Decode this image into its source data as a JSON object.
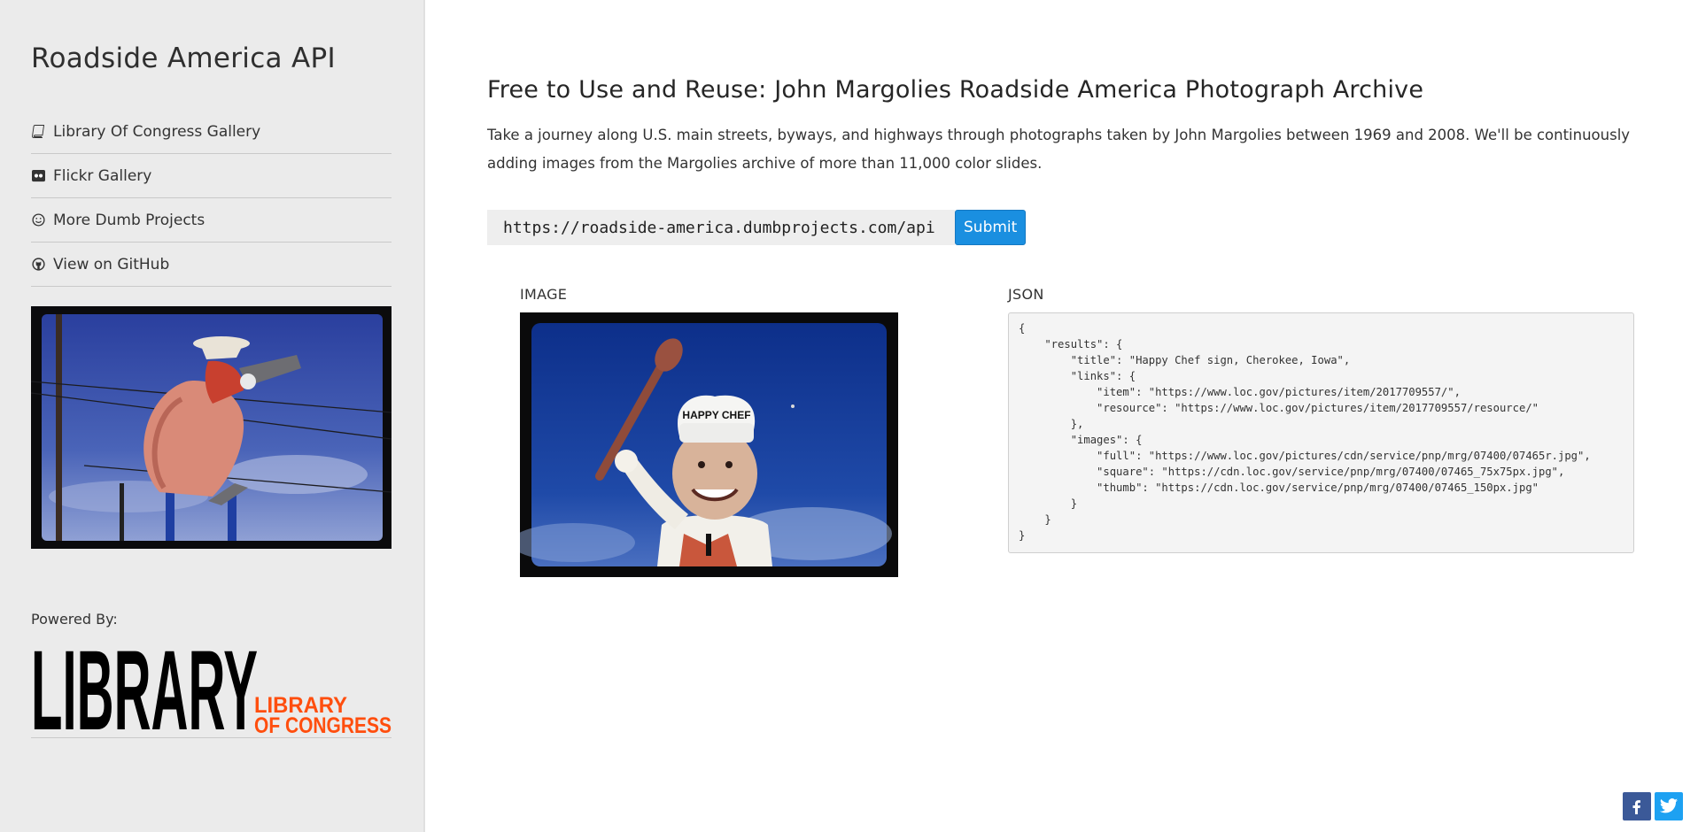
{
  "sidebar": {
    "title": "Roadside America API",
    "nav": [
      {
        "label": "Library Of Congress Gallery",
        "icon": "book-icon"
      },
      {
        "label": "Flickr Gallery",
        "icon": "flickr-icon"
      },
      {
        "label": "More Dumb Projects",
        "icon": "smile-icon"
      },
      {
        "label": "View on GitHub",
        "icon": "github-icon"
      }
    ],
    "photo_alt": "Giant shrimp cowboy sign",
    "powered_by": "Powered By:",
    "logo": {
      "big": "LIBRARY",
      "line1": "LIBRARY",
      "line2": "OF CONGRESS"
    }
  },
  "main": {
    "heading": "Free to Use and Reuse: John Margolies Roadside America Photograph Archive",
    "intro": "Take a journey along U.S. main streets, byways, and highways through photographs taken by John Margolies between 1969 and 2008. We'll be continuously adding images from the Margolies archive of more than 11,000 color slides.",
    "api_url": "https://roadside-america.dumbprojects.com/api",
    "submit_label": "Submit",
    "image_label": "IMAGE",
    "json_label": "JSON",
    "json_text": "{\n    \"results\": {\n        \"title\": \"Happy Chef sign, Cherokee, Iowa\",\n        \"links\": {\n            \"item\": \"https://www.loc.gov/pictures/item/2017709557/\",\n            \"resource\": \"https://www.loc.gov/pictures/item/2017709557/resource/\"\n        },\n        \"images\": {\n            \"full\": \"https://www.loc.gov/pictures/cdn/service/pnp/mrg/07400/07465r.jpg\",\n            \"square\": \"https://cdn.loc.gov/service/pnp/mrg/07400/07465_75x75px.jpg\",\n            \"thumb\": \"https://cdn.loc.gov/service/pnp/mrg/07400/07465_150px.jpg\"\n        }\n    }\n}",
    "sign_text": "HAPPY CHEF"
  },
  "share": {
    "facebook_icon": "facebook-icon",
    "twitter_icon": "twitter-icon"
  },
  "colors": {
    "accent": "#1a8fe0",
    "loc_orange": "#ff4e0e",
    "sidebar_bg": "#ebebeb"
  }
}
